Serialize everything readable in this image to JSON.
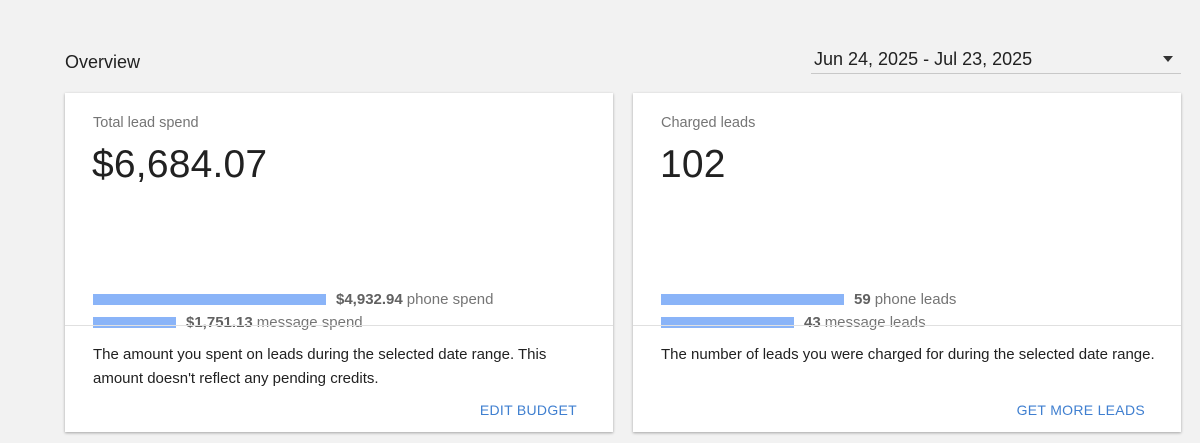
{
  "overview": {
    "title": "Overview"
  },
  "date_range": {
    "value": "Jun 24, 2025 - Jul 23, 2025"
  },
  "cards": [
    {
      "label": "Total lead spend",
      "value": "$6,684.07",
      "metrics": [
        {
          "value": "$4,932.94",
          "unit": "phone spend",
          "fraction": 0.738
        },
        {
          "value": "$1,751.13",
          "unit": "message spend",
          "fraction": 0.262
        }
      ],
      "description": "The amount you spent on leads during the selected date range. This amount doesn't reflect any pending credits.",
      "action_label": "EDIT BUDGET"
    },
    {
      "label": "Charged leads",
      "value": "102",
      "metrics": [
        {
          "value": "59",
          "unit": "phone leads",
          "fraction": 0.578
        },
        {
          "value": "43",
          "unit": "message leads",
          "fraction": 0.422
        }
      ],
      "description": "The number of leads you were charged for during the selected date range.",
      "action_label": "GET MORE LEADS"
    }
  ],
  "colors": {
    "bar": "#8ab4f8",
    "link": "#3f7fd0",
    "background": "#f2f2f2"
  }
}
